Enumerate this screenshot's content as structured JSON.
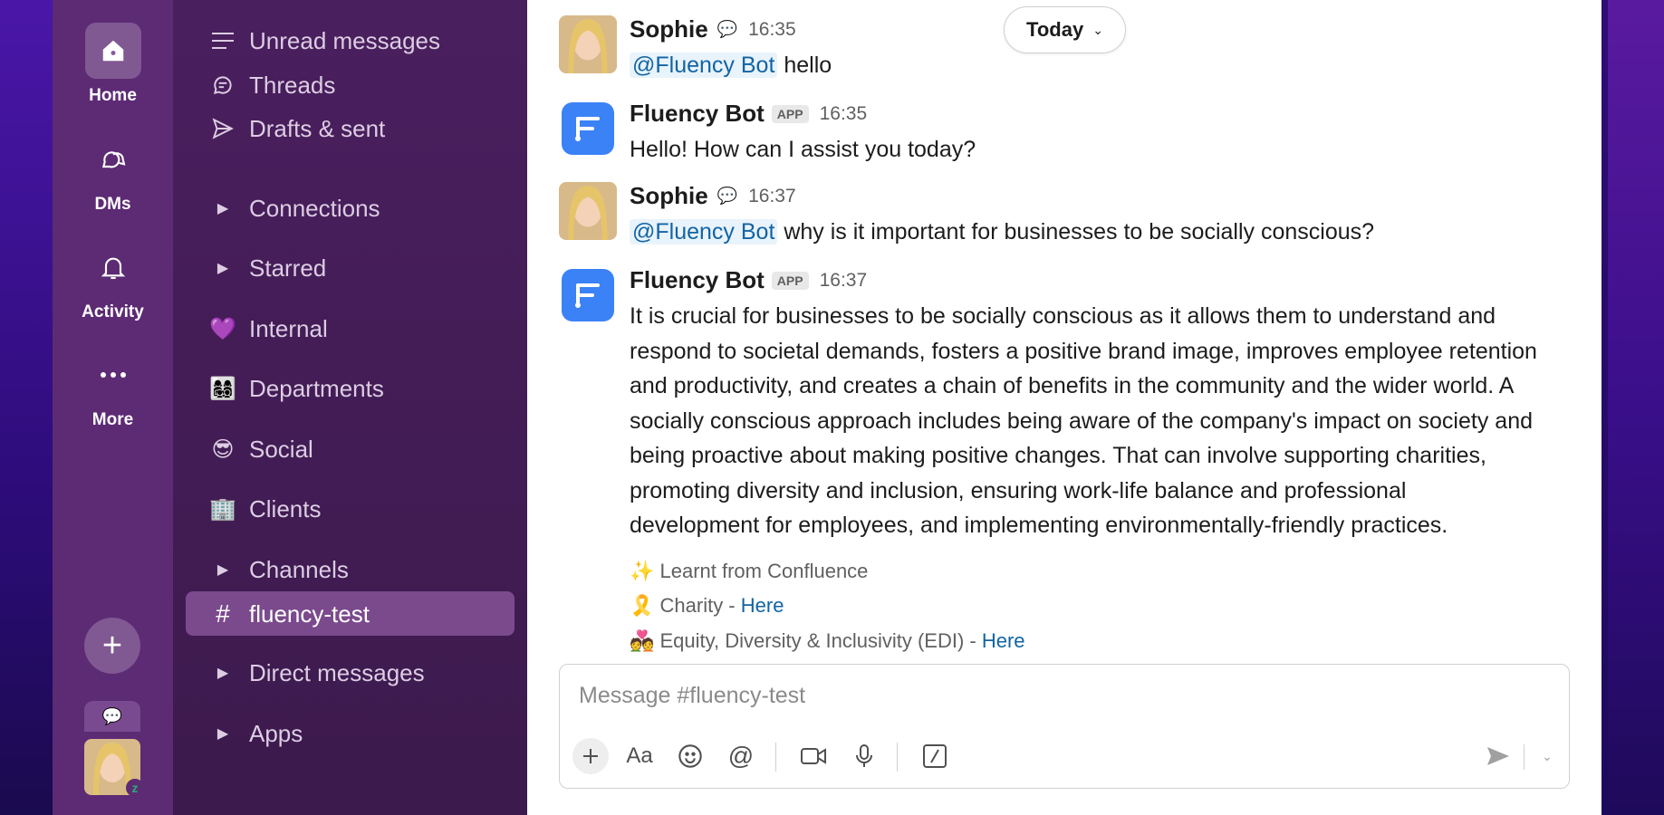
{
  "rail": {
    "items": [
      {
        "label": "Home",
        "icon": "home-icon"
      },
      {
        "label": "DMs",
        "icon": "dms-icon"
      },
      {
        "label": "Activity",
        "icon": "bell-icon"
      },
      {
        "label": "More",
        "icon": "more-icon"
      }
    ],
    "add_icon": "plus-icon"
  },
  "sidebar": {
    "top": [
      {
        "label": "Unread messages",
        "icon": "unread-icon"
      },
      {
        "label": "Threads",
        "icon": "threads-icon"
      },
      {
        "label": "Drafts & sent",
        "icon": "send-icon"
      }
    ],
    "sections": [
      {
        "label": "Connections",
        "type": "collapsible"
      },
      {
        "label": "Starred",
        "type": "collapsible"
      },
      {
        "label": "Internal",
        "emoji": "💜"
      },
      {
        "label": "Departments",
        "emoji": "👩‍👩‍👧‍👦"
      },
      {
        "label": "Social",
        "emoji": "😎"
      },
      {
        "label": "Clients",
        "emoji": "🏢"
      },
      {
        "label": "Channels",
        "type": "collapsible"
      },
      {
        "label": "fluency-test",
        "type": "channel",
        "active": true
      },
      {
        "label": "Direct messages",
        "type": "collapsible"
      },
      {
        "label": "Apps",
        "type": "collapsible"
      }
    ]
  },
  "main": {
    "date_divider": "Today",
    "messages": [
      {
        "author": "Sophie",
        "time": "16:35",
        "mention": "@Fluency Bot",
        "text": "hello"
      },
      {
        "author": "Fluency Bot",
        "badge": "APP",
        "time": "16:35",
        "text": "Hello! How can I assist you today?"
      },
      {
        "author": "Sophie",
        "time": "16:37",
        "mention": "@Fluency Bot",
        "text": "why is it important for businesses to be socially conscious?"
      },
      {
        "author": "Fluency Bot",
        "badge": "APP",
        "time": "16:37",
        "lines": [
          "It is crucial for businesses to be socially conscious as it allows them to understand and",
          "respond to societal demands, fosters a positive brand image, improves employee retention",
          "and productivity, and creates a chain of benefits in the community and the wider world. A",
          "socially conscious approach includes being aware of the company's impact on society and",
          "being proactive about making positive changes. That can involve supporting charities,",
          "promoting diversity and inclusion, ensuring work-life balance and professional",
          "development for employees, and implementing environmentally-friendly practices."
        ],
        "sources": {
          "learnt": "✨ Learnt from Confluence",
          "charity_prefix": "🎗️ Charity - ",
          "charity_link": "Here",
          "edi_prefix": "💑 Equity, Diversity & Inclusivity (EDI) - ",
          "edi_link": "Here"
        }
      }
    ],
    "composer": {
      "placeholder": "Message #fluency-test"
    }
  },
  "colors": {
    "rail": "#5d2a74",
    "sidebar": "#4a1f5e",
    "active": "#7b4a8d",
    "link": "#1264a3"
  }
}
